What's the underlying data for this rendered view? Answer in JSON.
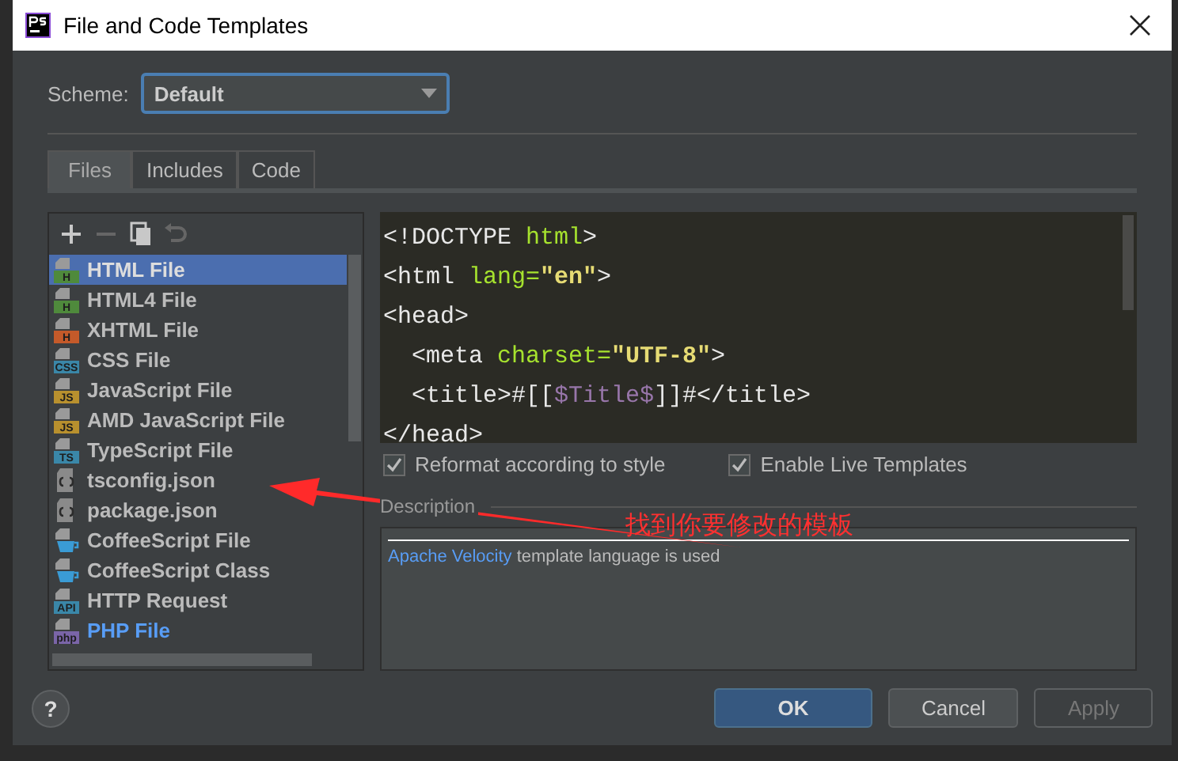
{
  "window": {
    "title": "File and Code Templates"
  },
  "scheme": {
    "label": "Scheme:",
    "value": "Default"
  },
  "tabs": [
    {
      "label": "Files",
      "selected": true
    },
    {
      "label": "Includes",
      "selected": false
    },
    {
      "label": "Code",
      "selected": false
    }
  ],
  "toolbar": [
    {
      "kind": "add",
      "disabled": false
    },
    {
      "kind": "remove",
      "disabled": true
    },
    {
      "kind": "copy",
      "disabled": false
    },
    {
      "kind": "reset",
      "disabled": true
    }
  ],
  "templates": [
    {
      "name": "HTML File",
      "kind": "badge",
      "badge": "H",
      "color": "#4f8a3c",
      "selected": true,
      "modified": false
    },
    {
      "name": "HTML4 File",
      "kind": "badge",
      "badge": "H",
      "color": "#4f8a3c",
      "selected": false,
      "modified": false
    },
    {
      "name": "XHTML File",
      "kind": "badge",
      "badge": "H",
      "color": "#c45a2a",
      "selected": false,
      "modified": false
    },
    {
      "name": "CSS File",
      "kind": "badge",
      "badge": "CSS",
      "color": "#3a87a8",
      "selected": false,
      "modified": false
    },
    {
      "name": "JavaScript File",
      "kind": "badge",
      "badge": "JS",
      "color": "#b8902e",
      "selected": false,
      "modified": false
    },
    {
      "name": "AMD JavaScript File",
      "kind": "badge",
      "badge": "JS",
      "color": "#b8902e",
      "selected": false,
      "modified": false
    },
    {
      "name": "TypeScript File",
      "kind": "badge",
      "badge": "TS",
      "color": "#3a87a8",
      "selected": false,
      "modified": false
    },
    {
      "name": "tsconfig.json",
      "kind": "json",
      "selected": false,
      "modified": false
    },
    {
      "name": "package.json",
      "kind": "json",
      "selected": false,
      "modified": false
    },
    {
      "name": "CoffeeScript File",
      "kind": "coffee",
      "selected": false,
      "modified": false
    },
    {
      "name": "CoffeeScript Class",
      "kind": "coffee",
      "selected": false,
      "modified": false
    },
    {
      "name": "HTTP Request",
      "kind": "badge",
      "badge": "API",
      "color": "#3a87a8",
      "selected": false,
      "modified": false
    },
    {
      "name": "PHP File",
      "kind": "badge",
      "badge": "php",
      "color": "#7a65a8",
      "selected": false,
      "modified": true
    }
  ],
  "code_lines": [
    [
      {
        "text": "<!DOCTYPE ",
        "kind": "tag"
      },
      {
        "text": "html",
        "kind": "attr"
      },
      {
        "text": ">",
        "kind": "tag"
      }
    ],
    [
      {
        "text": "<html ",
        "kind": "tag"
      },
      {
        "text": "lang=",
        "kind": "attr"
      },
      {
        "text": "\"en\"",
        "kind": "string"
      },
      {
        "text": ">",
        "kind": "tag"
      }
    ],
    [
      {
        "text": "<head>",
        "kind": "tag"
      }
    ],
    [
      {
        "text": "  <meta ",
        "kind": "tag"
      },
      {
        "text": "charset=",
        "kind": "attr"
      },
      {
        "text": "\"UTF-8\"",
        "kind": "string"
      },
      {
        "text": ">",
        "kind": "tag"
      }
    ],
    [
      {
        "text": "  <title>#[[",
        "kind": "tag"
      },
      {
        "text": "$Title$",
        "kind": "var"
      },
      {
        "text": "]]#</title>",
        "kind": "tag"
      }
    ],
    [
      {
        "text": "</head>",
        "kind": "tag"
      }
    ]
  ],
  "options": [
    {
      "label": "Reformat according to style",
      "checked": true
    },
    {
      "label": "Enable Live Templates",
      "checked": true
    }
  ],
  "description": {
    "label": "Description",
    "link": "Apache Velocity",
    "text": " template language is used"
  },
  "annotation": {
    "text": "找到你要修改的模板"
  },
  "help": {
    "label": "?"
  },
  "buttons": [
    {
      "label": "OK",
      "kind": "primary",
      "disabled": false
    },
    {
      "label": "Cancel",
      "kind": "normal",
      "disabled": false
    },
    {
      "label": "Apply",
      "kind": "normal",
      "disabled": true
    }
  ]
}
